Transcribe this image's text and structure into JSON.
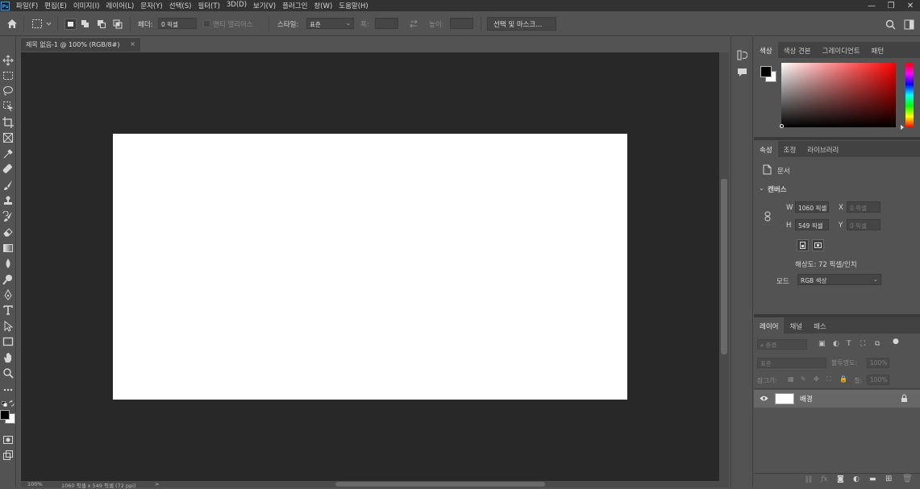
{
  "app": {
    "logo": "Ps"
  },
  "menu": [
    "파일(F)",
    "편집(E)",
    "이미지(I)",
    "레이어(L)",
    "문자(Y)",
    "선택(S)",
    "필터(T)",
    "3D(D)",
    "보기(V)",
    "플러그인",
    "창(W)",
    "도움말(H)"
  ],
  "window_controls": {
    "minimize": "—",
    "restore": "❐",
    "close": "✕"
  },
  "options": {
    "feather_label": "페더:",
    "feather_value": "0 픽셀",
    "antialias_label": "앤티 앨리어스",
    "style_label": "스타일:",
    "style_value": "표준",
    "width_label": "폭:",
    "height_label": "높이:",
    "select_mask_button": "선택 및 마스크..."
  },
  "document": {
    "tab_title": "제목 없음-1 @ 100% (RGB/8#)",
    "zoom": "100%",
    "status_info": "1060 픽셀 x 549 픽셀 (72 ppi)",
    "status_arrow": ">"
  },
  "color_panel": {
    "tabs": [
      "색상",
      "색상 견본",
      "그레이디언트",
      "패턴"
    ],
    "active_tab": 0,
    "hue_color": "#ff0000"
  },
  "properties_panel": {
    "tabs": [
      "속성",
      "조정",
      "라이브러리"
    ],
    "active_tab": 0,
    "doc_label": "문서",
    "canvas_section": "캔버스",
    "w_label": "W",
    "w_value": "1060 픽셀",
    "h_label": "H",
    "h_value": "549 픽셀",
    "x_label": "X",
    "x_value": "0 픽셀",
    "y_label": "Y",
    "y_value": "0 픽셀",
    "resolution": "해상도: 72 픽셀/인치",
    "mode_label": "모드",
    "mode_value": "RGB 색상"
  },
  "layers_panel": {
    "tabs": [
      "레이어",
      "채널",
      "패스"
    ],
    "active_tab": 0,
    "filter_placeholder": "종류",
    "blend_mode": "표준",
    "opacity_label": "불투명도:",
    "opacity_value": "100%",
    "lock_label": "잠그기:",
    "fill_label": "칠:",
    "fill_value": "100%",
    "layers": [
      {
        "name": "배경",
        "visible": true,
        "locked": true
      }
    ]
  }
}
